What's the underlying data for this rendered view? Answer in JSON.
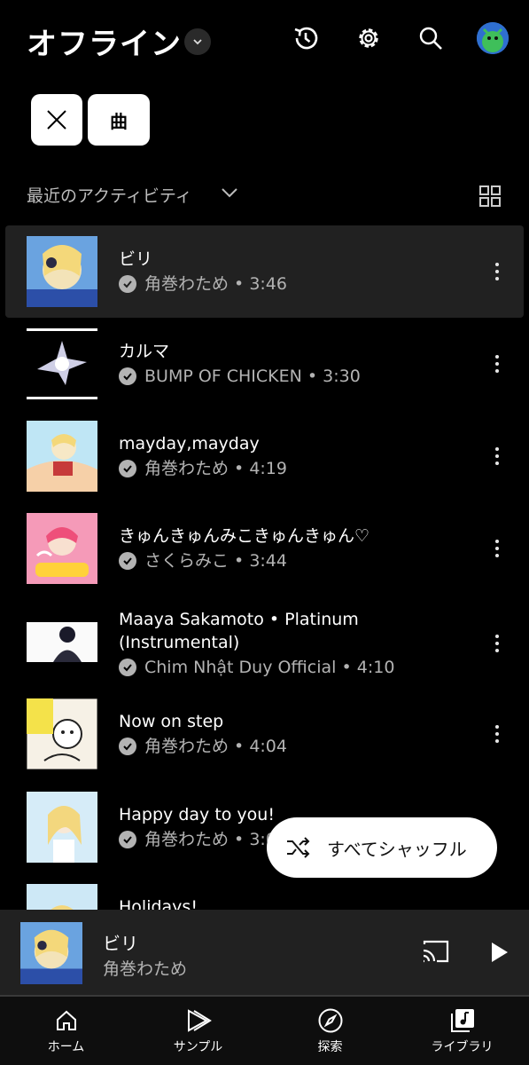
{
  "header": {
    "title": "オフライン",
    "icons": [
      "history-icon",
      "settings-icon",
      "search-icon",
      "avatar"
    ]
  },
  "filters": {
    "chip_label": "曲"
  },
  "sort": {
    "label": "最近のアクティビティ"
  },
  "songs": [
    {
      "title": "ビリ",
      "artist": "角巻わため",
      "duration": "3:46",
      "selected": true
    },
    {
      "title": "カルマ",
      "artist": "BUMP OF CHICKEN",
      "duration": "3:30"
    },
    {
      "title": "mayday,mayday",
      "artist": "角巻わため",
      "duration": "4:19"
    },
    {
      "title": "きゅんきゅんみこきゅんきゅん♡",
      "artist": "さくらみこ",
      "duration": "3:44"
    },
    {
      "title_line1": "Maaya Sakamoto • Platinum",
      "title_line2": "(Instrumental)",
      "artist": "Chim Nhật Duy Official ",
      "duration": "4:10"
    },
    {
      "title": "Now on step",
      "artist": "角巻わため",
      "duration": "4:04"
    },
    {
      "title": "Happy day to you!",
      "artist": "角巻わため",
      "duration": "3:0"
    },
    {
      "title": "Holidays!"
    }
  ],
  "shuffle": {
    "label": "すべてシャッフル"
  },
  "now_playing": {
    "title": "ビリ",
    "artist": "角巻わため"
  },
  "nav": {
    "items": [
      {
        "label": "ホーム",
        "icon": "home-icon"
      },
      {
        "label": "サンプル",
        "icon": "samples-icon"
      },
      {
        "label": "探索",
        "icon": "explore-icon"
      },
      {
        "label": "ライブラリ",
        "icon": "library-icon",
        "active": true
      }
    ]
  },
  "colors": {
    "background": "#000000",
    "surface": "#212121",
    "secondary_text": "#b3b3b3"
  }
}
